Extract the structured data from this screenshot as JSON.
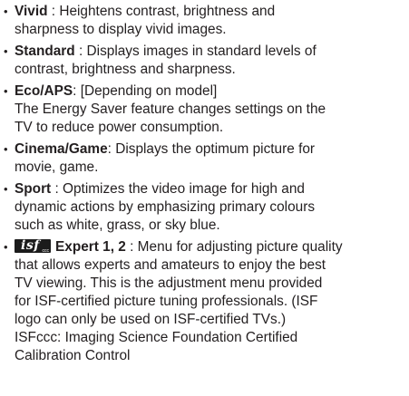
{
  "bullet": "•",
  "items": [
    {
      "term": "Vivid",
      "lines": [
        " : Heightens contrast, brightness and",
        "sharpness to display vivid images."
      ]
    },
    {
      "term": "Standard",
      "lines": [
        " : Displays images in standard levels of",
        "contrast, brightness and sharpness."
      ]
    },
    {
      "term": "Eco/APS",
      "lines": [
        ": [Depending on model]",
        "The Energy Saver feature changes settings on the",
        "TV to reduce power consumption."
      ]
    },
    {
      "term": "Cinema/Game",
      "lines": [
        ": Displays the optimum picture for",
        "movie, game."
      ]
    },
    {
      "term": "Sport",
      "lines": [
        " : Optimizes the video image for high and",
        "dynamic actions by emphasizing primary colours",
        "such as white, grass, or sky blue."
      ]
    },
    {
      "term": "Expert 1, 2",
      "logo": {
        "text": "isf",
        "sub": "ccc",
        "icon": "isf-logo-icon"
      },
      "lines": [
        " : Menu for adjusting picture quality",
        "that allows experts and amateurs to enjoy the best",
        "TV viewing. This is the adjustment menu provided",
        "for ISF-certified picture tuning professionals. (ISF",
        "logo can only be used on ISF-certified TVs.)",
        "ISFccc: Imaging Science Foundation Certified",
        "Calibration Control"
      ]
    }
  ]
}
